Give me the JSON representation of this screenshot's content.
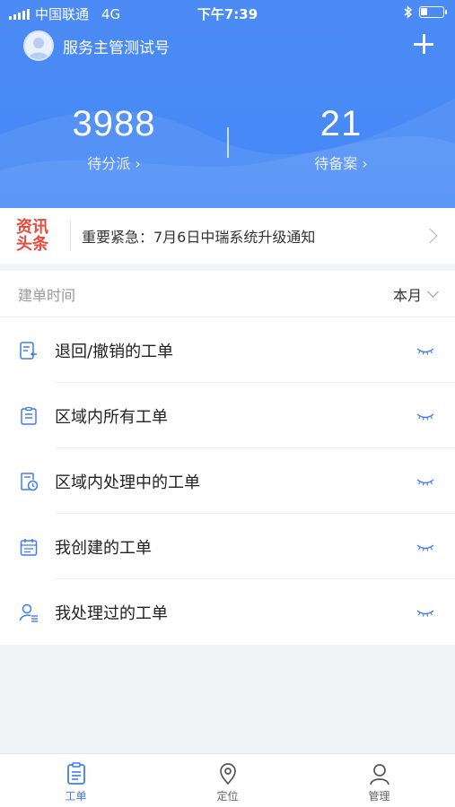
{
  "status_bar": {
    "carrier": "中国联通",
    "network": "4G",
    "time": "下午7:39"
  },
  "header": {
    "user_name": "服务主管测试号",
    "stats": [
      {
        "value": "3988",
        "label": "待分派 ›"
      },
      {
        "value": "21",
        "label": "待备案 ›"
      }
    ]
  },
  "news": {
    "logo_line1": "资讯",
    "logo_line2": "头条",
    "text": "重要紧急：7月6日中瑞系统升级通知"
  },
  "filter": {
    "label": "建单时间",
    "value": "本月"
  },
  "items": [
    {
      "label": "退回/撤销的工单",
      "icon": "return-ticket-icon"
    },
    {
      "label": "区域内所有工单",
      "icon": "clipboard-icon"
    },
    {
      "label": "区域内处理中的工单",
      "icon": "clock-doc-icon"
    },
    {
      "label": "我创建的工单",
      "icon": "calendar-icon"
    },
    {
      "label": "我处理过的工单",
      "icon": "user-list-icon"
    }
  ],
  "tabs": [
    {
      "label": "工单",
      "icon": "workorder-icon",
      "active": true
    },
    {
      "label": "定位",
      "icon": "location-icon",
      "active": false
    },
    {
      "label": "管理",
      "icon": "person-icon",
      "active": false
    }
  ],
  "colors": {
    "primary": "#4488f6",
    "news_red": "#e84a3c",
    "icon_blue": "#3b7cf5"
  }
}
